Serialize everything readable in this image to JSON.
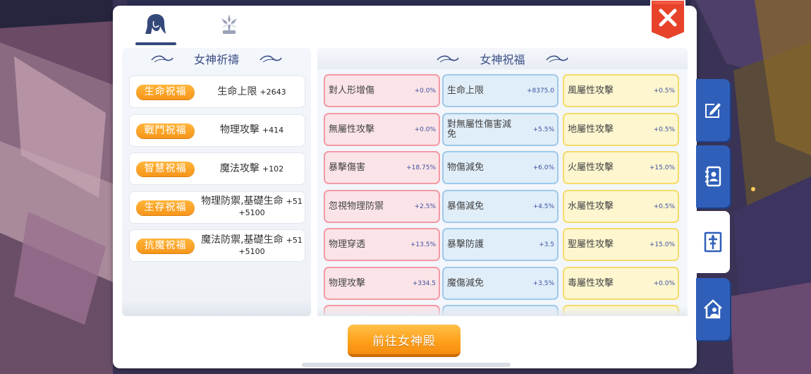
{
  "tabs": [
    {
      "icon": "goddess-portrait-icon",
      "active": true
    },
    {
      "icon": "snowflake-emblem-icon",
      "active": false
    }
  ],
  "close_icon": "close-icon",
  "prayer": {
    "title": "女神祈禱",
    "rows": [
      {
        "label": "生命祝福",
        "stat": "生命上限",
        "bonus": "+2643",
        "line2": ""
      },
      {
        "label": "戰鬥祝福",
        "stat": "物理攻擊",
        "bonus": "+414",
        "line2": ""
      },
      {
        "label": "智慧祝福",
        "stat": "魔法攻擊",
        "bonus": "+102",
        "line2": ""
      },
      {
        "label": "生存祝福",
        "stat": "物理防禦,基礎生命",
        "bonus": "+51",
        "line2": "+5100"
      },
      {
        "label": "抗魔祝福",
        "stat": "魔法防禦,基礎生命",
        "bonus": "+51",
        "line2": "+5100"
      }
    ]
  },
  "blessing": {
    "title": "女神祝福",
    "columns": [
      [
        {
          "name": "對人形增傷",
          "value": "+0.0%"
        },
        {
          "name": "無屬性攻擊",
          "value": "+0.0%"
        },
        {
          "name": "暴擊傷害",
          "value": "+18.75%"
        },
        {
          "name": "忽視物理防禦",
          "value": "+2.5%"
        },
        {
          "name": "物理穿透",
          "value": "+13.5%"
        },
        {
          "name": "物理攻擊",
          "value": "+334.5"
        }
      ],
      [
        {
          "name": "生命上限",
          "value": "+8375.0"
        },
        {
          "name": "對無屬性傷害減免",
          "value": "+5.5%"
        },
        {
          "name": "物傷減免",
          "value": "+6.0%"
        },
        {
          "name": "暴傷減免",
          "value": "+4.5%"
        },
        {
          "name": "暴擊防護",
          "value": "+3.5"
        },
        {
          "name": "魔傷減免",
          "value": "+3.5%"
        }
      ],
      [
        {
          "name": "風屬性攻擊",
          "value": "+0.5%"
        },
        {
          "name": "地屬性攻擊",
          "value": "+0.5%"
        },
        {
          "name": "火屬性攻擊",
          "value": "+15.0%"
        },
        {
          "name": "水屬性攻擊",
          "value": "+0.5%"
        },
        {
          "name": "聖屬性攻擊",
          "value": "+15.0%"
        },
        {
          "name": "毒屬性攻擊",
          "value": "+0.0%"
        }
      ]
    ]
  },
  "goto_button": "前往女神殿",
  "side_tabs": [
    {
      "icon": "edit-icon",
      "active": false
    },
    {
      "icon": "contact-book-icon",
      "active": false
    },
    {
      "icon": "goddess-altar-icon",
      "active": true
    },
    {
      "icon": "home-person-icon",
      "active": false
    }
  ],
  "colors": {
    "accent_orange": "#f7961a",
    "title_blue": "#3a4f86",
    "close_red": "#e8422b",
    "side_tab_blue": "#2f5fb9",
    "cell_pink": "#fbe4e7",
    "cell_blue": "#e0eef9",
    "cell_yellow": "#fdf6cf"
  }
}
